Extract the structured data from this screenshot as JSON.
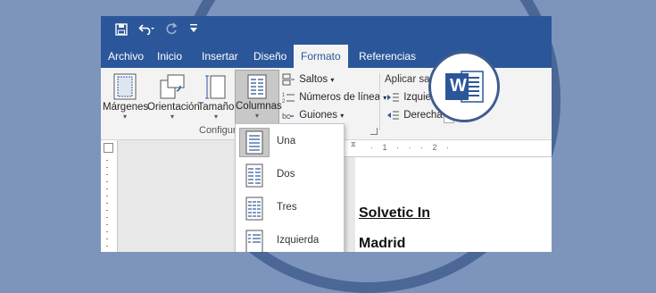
{
  "quick_access": {
    "save_icon": "save-icon",
    "undo_icon": "undo-icon",
    "redo_icon": "redo-icon",
    "customize_icon": "customize-icon"
  },
  "tabs": [
    {
      "label": "Archivo"
    },
    {
      "label": "Inicio"
    },
    {
      "label": "Insertar"
    },
    {
      "label": "Diseño"
    },
    {
      "label": "Formato",
      "active": true
    },
    {
      "label": "Referencias"
    }
  ],
  "ribbon": {
    "margins_label": "Márgenes",
    "orientation_label": "Orientación",
    "size_label": "Tamaño",
    "columns_label": "Columnas",
    "breaks_label": "Saltos",
    "line_numbers_label": "Números de línea",
    "hyphenation_label": "Guiones",
    "group_label": "Configur",
    "indent_header": "Aplicar san",
    "indent_left_label": "Izquierd",
    "indent_right_label": "Derecha:"
  },
  "columns_menu": [
    {
      "label": "Una",
      "selected": true
    },
    {
      "label": "Dos"
    },
    {
      "label": "Tres"
    },
    {
      "label": "Izquierda"
    }
  ],
  "document": {
    "line1": "Solvetic In",
    "line2": "Madrid"
  },
  "ruler": {
    "marks": "· 1 · · · 2 ·"
  },
  "logo": {
    "letter": "W"
  },
  "colors": {
    "word_blue": "#2b579a",
    "background": "#7d94bc",
    "ring": "#4a6796"
  }
}
